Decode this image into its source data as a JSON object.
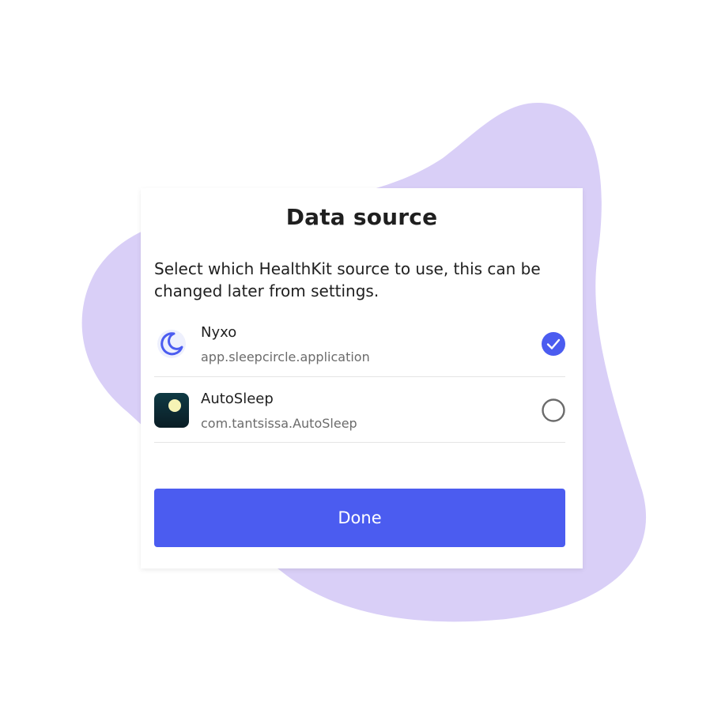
{
  "dialog": {
    "title": "Data source",
    "description": "Select which HealthKit source to use, this can be changed later from settings.",
    "sources": [
      {
        "name": "Nyxo",
        "bundle_id": "app.sleepcircle.application",
        "icon": "moon-icon",
        "selected": true
      },
      {
        "name": "AutoSleep",
        "bundle_id": "com.tantsissa.AutoSleep",
        "icon": "autosleep-app-icon",
        "selected": false
      }
    ],
    "done_label": "Done"
  },
  "colors": {
    "accent": "#4b5cf0",
    "blob": "#d9cff7",
    "text": "#1f1f1f",
    "secondary_text": "#6b6b6b"
  }
}
